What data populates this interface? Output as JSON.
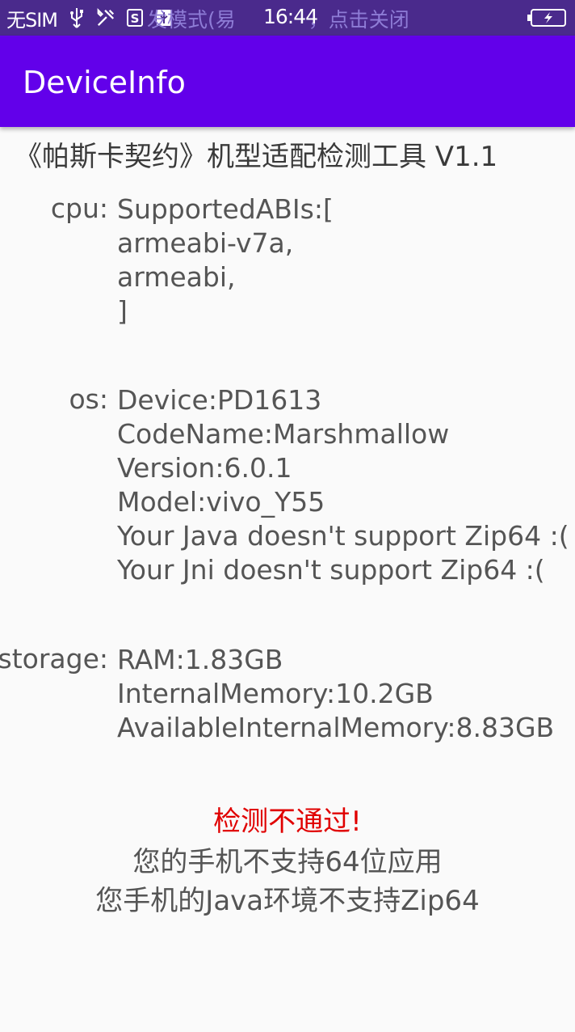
{
  "status_bar": {
    "carrier": "无SIM",
    "notice": "发模式(易",
    "notice_tail": "，点击关闭",
    "time": "16:44",
    "icons": [
      "usb-icon",
      "tools-icon",
      "s-app-icon",
      "usb-debug-icon",
      "battery-icon"
    ],
    "background": "#4a2a8c"
  },
  "app_bar": {
    "title": "DeviceInfo",
    "color": "#6200ea"
  },
  "header": "《帕斯卡契约》机型适配检测工具 V1.1",
  "cpu": {
    "label": "cpu:",
    "lines": [
      "SupportedABIs:[",
      "armeabi-v7a,",
      "armeabi,",
      "]"
    ]
  },
  "os": {
    "label": "os:",
    "lines": [
      "Device:PD1613",
      "CodeName:Marshmallow",
      "Version:6.0.1",
      "Model:vivo_Y55",
      "Your Java doesn't support Zip64 :(",
      "Your Jni doesn't support Zip64 :("
    ]
  },
  "storage": {
    "label": "storage:",
    "lines": [
      "RAM:1.83GB",
      "InternalMemory:10.2GB",
      "AvailableInternalMemory:8.83GB"
    ]
  },
  "result": {
    "status": "检测不通过!",
    "status_color": "#e00000",
    "reason_1": "您的手机不支持64位应用",
    "reason_2": "您手机的Java环境不支持Zip64"
  }
}
